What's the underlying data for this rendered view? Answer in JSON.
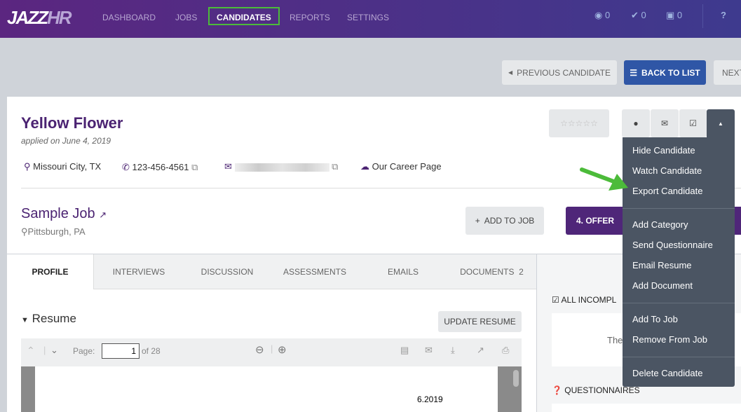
{
  "nav": {
    "logo_a": "JAZZ",
    "logo_b": "HR",
    "items": [
      "DASHBOARD",
      "JOBS",
      "CANDIDATES",
      "REPORTS",
      "SETTINGS"
    ],
    "active": "CANDIDATES",
    "watch_count": "0",
    "task_count": "0",
    "inbox_count": "0",
    "help": "?"
  },
  "pager": {
    "prev": "PREVIOUS CANDIDATE",
    "back": "BACK TO LIST",
    "next": "NEXT"
  },
  "candidate": {
    "name": "Yellow Flower",
    "applied": "applied on June 4, 2019",
    "location": "Missouri City, TX",
    "phone": "123-456-4561",
    "source": "Our Career Page",
    "rating_stars": "☆☆☆☆☆",
    "rating": 0
  },
  "job": {
    "title": "Sample Job",
    "location": "Pittsburgh, PA",
    "add_to_job": "ADD TO JOB",
    "stage": "4. OFFER"
  },
  "menu": {
    "group1": [
      "Hide Candidate",
      "Watch Candidate",
      "Export Candidate"
    ],
    "group2": [
      "Add Category",
      "Send Questionnaire",
      "Email Resume",
      "Add Document"
    ],
    "group3": [
      "Add To Job",
      "Remove From Job"
    ],
    "group4": [
      "Delete Candidate"
    ]
  },
  "tabs": [
    "PROFILE",
    "INTERVIEWS",
    "DISCUSSION",
    "ASSESSMENTS",
    "EMAILS",
    "DOCUMENTS"
  ],
  "documents_count": "2",
  "resume": {
    "heading": "Resume",
    "update": "UPDATE RESUME",
    "page_label": "Page:",
    "page": "1",
    "of": "of 28",
    "doc_text": "6.2019"
  },
  "sidebar": {
    "incomplete": "ALL INCOMPL",
    "partial": "The",
    "questionnaires": "QUESTIONNAIRES"
  },
  "colors": {
    "purple": "#4b2372",
    "blue": "#2f56a6",
    "menu": "#4b5563",
    "highlight": "#4cbb3a"
  }
}
